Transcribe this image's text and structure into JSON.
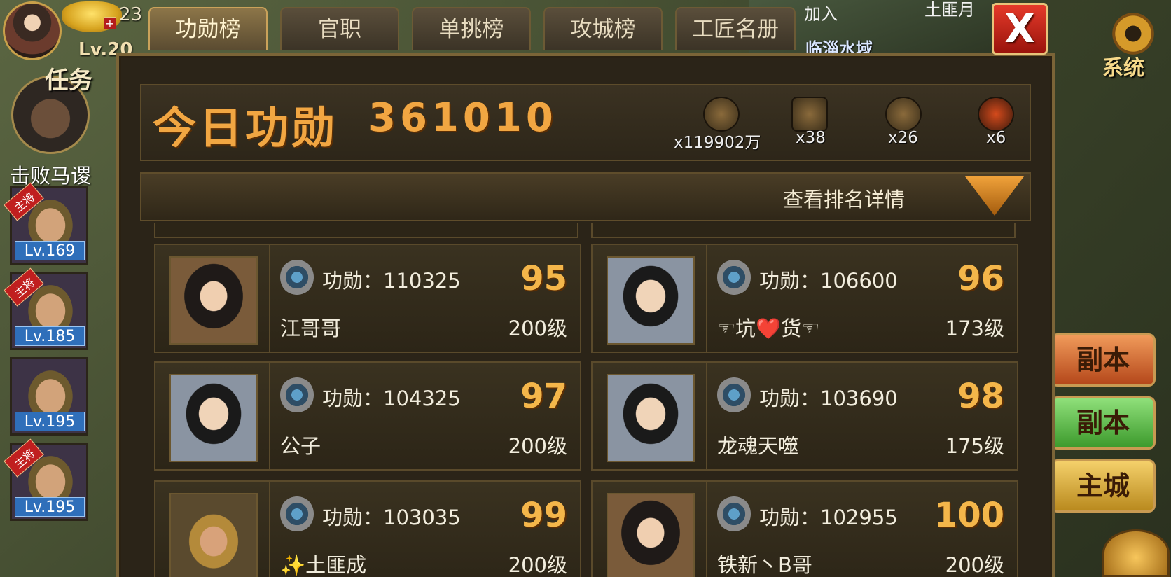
{
  "player": {
    "level": "Lv.20",
    "currency_top": "23",
    "plus": "+"
  },
  "quest": {
    "label": "任务",
    "text": "击败马谡"
  },
  "heroes": [
    {
      "tag": "主将",
      "level": "Lv.169"
    },
    {
      "tag": "主将",
      "level": "Lv.185"
    },
    {
      "tag": "",
      "level": "Lv.195"
    },
    {
      "tag": "主将",
      "level": "Lv.195"
    }
  ],
  "tabs": [
    "功勋榜",
    "官职",
    "单挑榜",
    "攻城榜",
    "工匠名册"
  ],
  "active_tab": 0,
  "close_label": "X",
  "system_label": "系统",
  "map_labels": {
    "water": "临淄水域",
    "join": "加入",
    "user": "土匪月"
  },
  "side_buttons": [
    "副本",
    "副本",
    "主城"
  ],
  "header": {
    "title": "今日功勋",
    "value": "361010"
  },
  "rewards": [
    "x119902万",
    "x38",
    "x26",
    "x6"
  ],
  "rank_detail": "查看排名详情",
  "score_label": "功勋：",
  "entries": [
    {
      "score": "110325",
      "rank": "95",
      "name": "江哥哥",
      "level": "200级"
    },
    {
      "score": "106600",
      "rank": "96",
      "name": "☜坑❤️货☜",
      "level": "173级"
    },
    {
      "score": "104325",
      "rank": "97",
      "name": "公子",
      "level": "200级"
    },
    {
      "score": "103690",
      "rank": "98",
      "name": "龙魂天噬",
      "level": "175级"
    },
    {
      "score": "103035",
      "rank": "99",
      "name": "✨土匪成",
      "level": "200级"
    },
    {
      "score": "102955",
      "rank": "100",
      "name": "铁新丶B哥",
      "level": "200级"
    }
  ],
  "colors": {
    "accent": "#f1a642",
    "panel": "#2b2418",
    "close": "#c92218"
  }
}
